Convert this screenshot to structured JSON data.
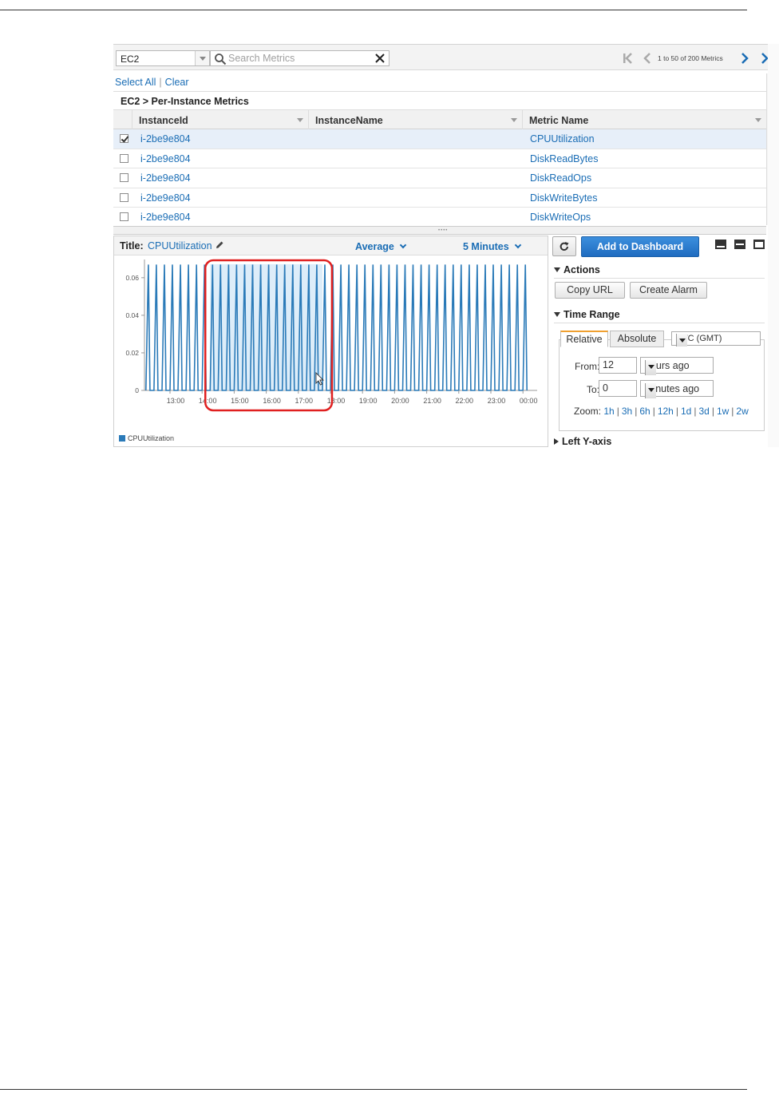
{
  "toolbar": {
    "namespace": "EC2",
    "search_placeholder": "Search Metrics",
    "pager_text": "1 to 50 of 200 Metrics"
  },
  "selection": {
    "select_all": "Select All",
    "separator": "|",
    "clear": "Clear"
  },
  "grid": {
    "title": "EC2 > Per-Instance Metrics",
    "columns": [
      "InstanceId",
      "InstanceName",
      "Metric Name"
    ],
    "rows": [
      {
        "instance_id": "i-2be9e804",
        "instance_name": "",
        "metric": "CPUUtilization",
        "checked": true
      },
      {
        "instance_id": "i-2be9e804",
        "instance_name": "",
        "metric": "DiskReadBytes",
        "checked": false
      },
      {
        "instance_id": "i-2be9e804",
        "instance_name": "",
        "metric": "DiskReadOps",
        "checked": false
      },
      {
        "instance_id": "i-2be9e804",
        "instance_name": "",
        "metric": "DiskWriteBytes",
        "checked": false
      },
      {
        "instance_id": "i-2be9e804",
        "instance_name": "",
        "metric": "DiskWriteOps",
        "checked": false
      }
    ]
  },
  "graph": {
    "title_label": "Title:",
    "title_value": "CPUUtilization",
    "statistic": "Average",
    "period": "5 Minutes"
  },
  "actions_panel": {
    "add_to_dashboard": "Add to Dashboard",
    "actions_heading": "Actions",
    "copy_url": "Copy URL",
    "create_alarm": "Create Alarm",
    "time_range_heading": "Time Range",
    "tabs": [
      "Relative",
      "Absolute"
    ],
    "timezone": "UTC (GMT)",
    "from_label": "From:",
    "from_value": "12",
    "from_unit": "hours ago",
    "to_label": "To:",
    "to_value": "0",
    "to_unit": "minutes ago",
    "zoom_label": "Zoom:",
    "zoom_options": [
      "1h",
      "3h",
      "6h",
      "12h",
      "1d",
      "3d",
      "1w",
      "2w"
    ],
    "left_y_axis_heading": "Left Y-axis"
  },
  "chart_data": {
    "type": "line",
    "series": [
      {
        "name": "CPUUtilization",
        "color": "#2a7ab8"
      }
    ],
    "x_tick_labels": [
      "13:00",
      "14:00",
      "15:00",
      "16:00",
      "17:00",
      "18:00",
      "19:00",
      "20:00",
      "21:00",
      "22:00",
      "23:00",
      "00:00"
    ],
    "y_tick_labels": [
      "0",
      "0.02",
      "0.04",
      "0.06"
    ],
    "ylim": [
      0,
      0.068
    ],
    "pattern": "periodic spikes alternating between 0 and ~0.067, about 4 spikes per hour",
    "spike_value": 0.067,
    "highlight": {
      "from": "14:15",
      "to": "17:45",
      "color": "#cfe6f7"
    },
    "annotation_box_color": "#e02020",
    "legend_position": "bottom-left"
  }
}
